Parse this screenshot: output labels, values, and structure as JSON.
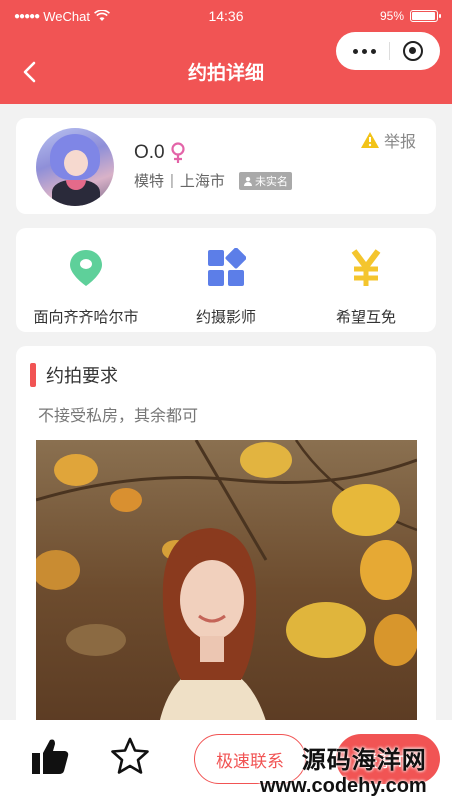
{
  "status_bar": {
    "carrier": "WeChat",
    "time": "14:36",
    "battery_percent": "95%",
    "battery_level": 0.95
  },
  "nav": {
    "title": "约拍详细"
  },
  "profile": {
    "name": "O.0",
    "role": "模特",
    "city": "上海市",
    "verify_label": "未实名",
    "report_label": "举报"
  },
  "info_items": [
    {
      "icon": "location-pin-icon",
      "label": "面向齐齐哈尔市",
      "color": "#5ed09a"
    },
    {
      "icon": "apps-grid-icon",
      "label": "约摄影师",
      "color": "#5c7ee8"
    },
    {
      "icon": "yen-icon",
      "label": "希望互免",
      "color": "#f4c52d"
    }
  ],
  "detail": {
    "section_title": "约拍要求",
    "requirement": "不接受私房，其余都可"
  },
  "bottom_bar": {
    "contact_label": "极速联系",
    "primary_label": "联系TA"
  },
  "watermark": {
    "name": "源码海洋网",
    "url": "www.codehy.com"
  },
  "colors": {
    "brand": "#f15454",
    "report_warning": "#f2c318"
  }
}
